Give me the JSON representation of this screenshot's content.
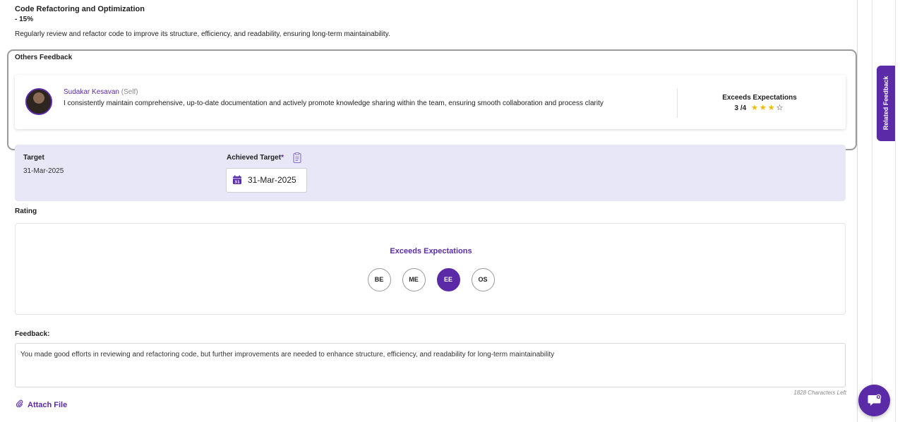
{
  "objective": {
    "title": "Code Refactoring and Optimization",
    "weight": "- 15%",
    "description": "Regularly review and refactor code to improve its structure, efficiency, and readability, ensuring long-term maintainability."
  },
  "others_feedback": {
    "section_title": "Others Feedback",
    "items": [
      {
        "name": "Sudakar Kesavan",
        "relation": "(Self)",
        "comment": "I consistently maintain comprehensive, up-to-date documentation and actively promote knowledge sharing within the team, ensuring smooth collaboration and process clarity",
        "rating_label": "Exceeds Expectations",
        "rating_value": "3 /4",
        "stars_filled": 3,
        "stars_total": 4
      }
    ]
  },
  "target": {
    "label": "Target",
    "value": "31-Mar-2025",
    "achieved_label": "Achieved Target",
    "required_mark": "*",
    "achieved_value": "31-Mar-2025"
  },
  "rating": {
    "title": "Rating",
    "selected_label": "Exceeds Expectations",
    "options": [
      "BE",
      "ME",
      "EE",
      "OS"
    ],
    "selected": "EE"
  },
  "feedback": {
    "title": "Feedback:",
    "text": "You made good efforts in reviewing and refactoring code, but further improvements are needed to enhance structure, efficiency, and readability for long-term maintainability",
    "chars_left": "1828 Characters Left"
  },
  "attach": {
    "label": "Attach File"
  },
  "sidebar": {
    "related_feedback_label": "Related Feedback"
  },
  "colors": {
    "accent": "#5b2aa6",
    "panel": "#e8e7f7",
    "star": "#f1b900"
  },
  "icons": {
    "attach": "paperclip-icon",
    "calendar": "calendar-icon",
    "document": "document-icon",
    "chat": "chat-icon"
  }
}
